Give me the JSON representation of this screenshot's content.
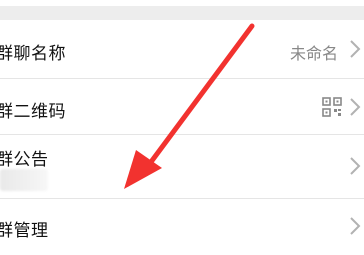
{
  "group_settings": {
    "rows": [
      {
        "label": "群聊名称",
        "value": "未命名"
      },
      {
        "label": "群二维码"
      },
      {
        "label": "群公告"
      },
      {
        "label": "群管理"
      }
    ]
  },
  "icons": {
    "chevron": "chevron-right-icon",
    "qr": "qr-code-icon"
  },
  "colors": {
    "annotation_arrow": "#f2322f",
    "background": "#ededed",
    "panel": "#ffffff"
  }
}
